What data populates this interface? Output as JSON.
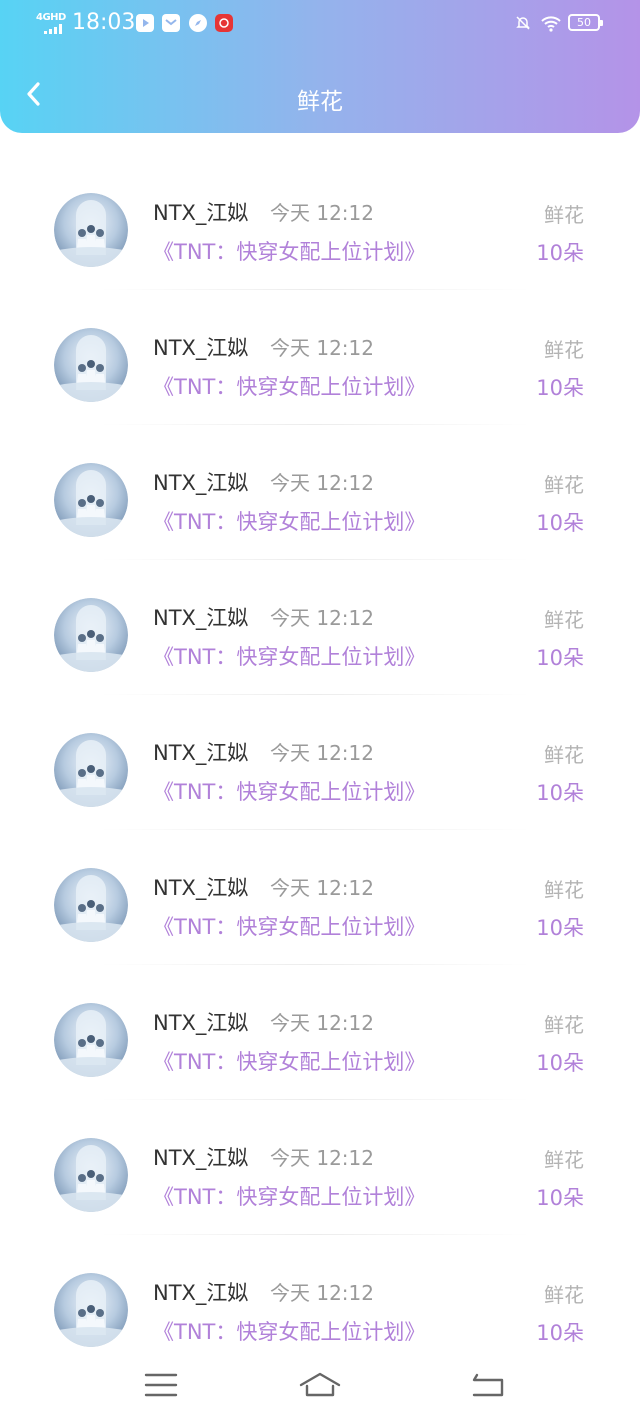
{
  "status_bar": {
    "network": "4GHD",
    "time": "18:03",
    "battery": "50"
  },
  "header": {
    "title": "鲜花"
  },
  "records": [
    {
      "user": "NTX_江姒",
      "time": "今天 12:12",
      "book": "《TNT：快穿女配上位计划》",
      "type": "鲜花",
      "amount": "10朵"
    },
    {
      "user": "NTX_江姒",
      "time": "今天 12:12",
      "book": "《TNT：快穿女配上位计划》",
      "type": "鲜花",
      "amount": "10朵"
    },
    {
      "user": "NTX_江姒",
      "time": "今天 12:12",
      "book": "《TNT：快穿女配上位计划》",
      "type": "鲜花",
      "amount": "10朵"
    },
    {
      "user": "NTX_江姒",
      "time": "今天 12:12",
      "book": "《TNT：快穿女配上位计划》",
      "type": "鲜花",
      "amount": "10朵"
    },
    {
      "user": "NTX_江姒",
      "time": "今天 12:12",
      "book": "《TNT：快穿女配上位计划》",
      "type": "鲜花",
      "amount": "10朵"
    },
    {
      "user": "NTX_江姒",
      "time": "今天 12:12",
      "book": "《TNT：快穿女配上位计划》",
      "type": "鲜花",
      "amount": "10朵"
    },
    {
      "user": "NTX_江姒",
      "time": "今天 12:12",
      "book": "《TNT：快穿女配上位计划》",
      "type": "鲜花",
      "amount": "10朵"
    },
    {
      "user": "NTX_江姒",
      "time": "今天 12:12",
      "book": "《TNT：快穿女配上位计划》",
      "type": "鲜花",
      "amount": "10朵"
    },
    {
      "user": "NTX_江姒",
      "time": "今天 12:12",
      "book": "《TNT：快穿女配上位计划》",
      "type": "鲜花",
      "amount": "10朵"
    }
  ],
  "colors": {
    "header_gradient_start": "#57d3f4",
    "header_gradient_end": "#b493e8",
    "accent": "#b181d9",
    "muted": "#9a9a9a"
  },
  "icons": {
    "back": "chevron-left-icon",
    "menu": "menu-icon",
    "home": "home-icon",
    "return": "return-icon"
  }
}
